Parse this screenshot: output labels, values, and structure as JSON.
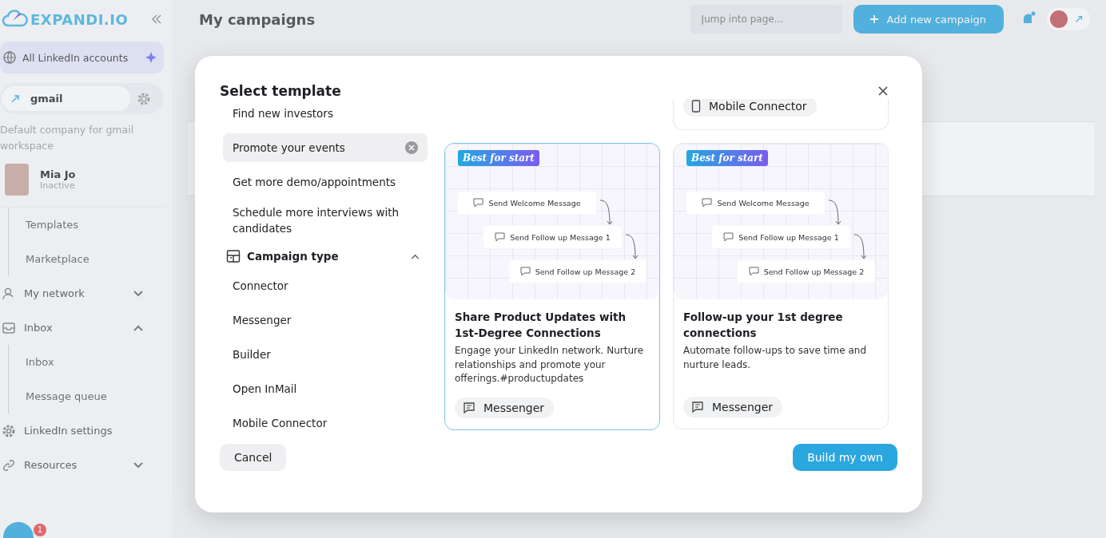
{
  "sidebar": {
    "logo": "EXPANDI.IO",
    "accounts": {
      "label": "All LinkedIn accounts",
      "selected": true
    },
    "workspace": "gmail",
    "workspace_note": "Default company for gmail workspace",
    "user": {
      "name": "Mia Jo",
      "status": "Inactive"
    },
    "items": [
      {
        "children": [
          {
            "label": "Templates"
          },
          {
            "label": "Marketplace"
          }
        ]
      },
      {
        "label": "My network",
        "expanded": false
      },
      {
        "label": "Inbox",
        "expanded": true,
        "children": [
          {
            "label": "Inbox"
          },
          {
            "label": "Message queue"
          }
        ]
      },
      {
        "label": "LinkedIn settings"
      },
      {
        "label": "Resources",
        "expanded": false
      }
    ]
  },
  "header": {
    "title": "My campaigns",
    "search_placeholder": "Jump into page...",
    "add_button": "Add new campaign"
  },
  "chat_badge": "1",
  "modal": {
    "title": "Select template",
    "goals": [
      {
        "label": "Find new investors",
        "selected": false
      },
      {
        "label": "Promote your events",
        "selected": true
      },
      {
        "label": "Get more demo/appointments",
        "selected": false
      },
      {
        "label": "Schedule more interviews with candidates",
        "selected": false
      }
    ],
    "campaign_type": {
      "label": "Campaign type",
      "expanded": true,
      "items": [
        "Connector",
        "Messenger",
        "Builder",
        "Open InMail",
        "Mobile Connector"
      ]
    },
    "top_card": {
      "tag": "Mobile Connector",
      "kind": "mobile"
    },
    "cards": [
      {
        "badge": "Best for start",
        "steps": [
          "Send Welcome Message",
          "Send Follow up Message 1",
          "Send Follow up Message 2"
        ],
        "title": "Share Product Updates with 1st-Degree Connections",
        "description": "Engage your LinkedIn network. Nurture relationships and promote your offerings.#productupdates",
        "tag": "Messenger",
        "kind": "messenger",
        "selected": true
      },
      {
        "badge": "Best for start",
        "steps": [
          "Send Welcome Message",
          "Send Follow up Message 1",
          "Send Follow up Message 2"
        ],
        "title": "Follow-up your 1st degree connections",
        "description": "Automate follow-ups to save time and nurture leads.",
        "tag": "Messenger",
        "kind": "messenger",
        "selected": false
      }
    ],
    "cancel": "Cancel",
    "build": "Build my own"
  }
}
